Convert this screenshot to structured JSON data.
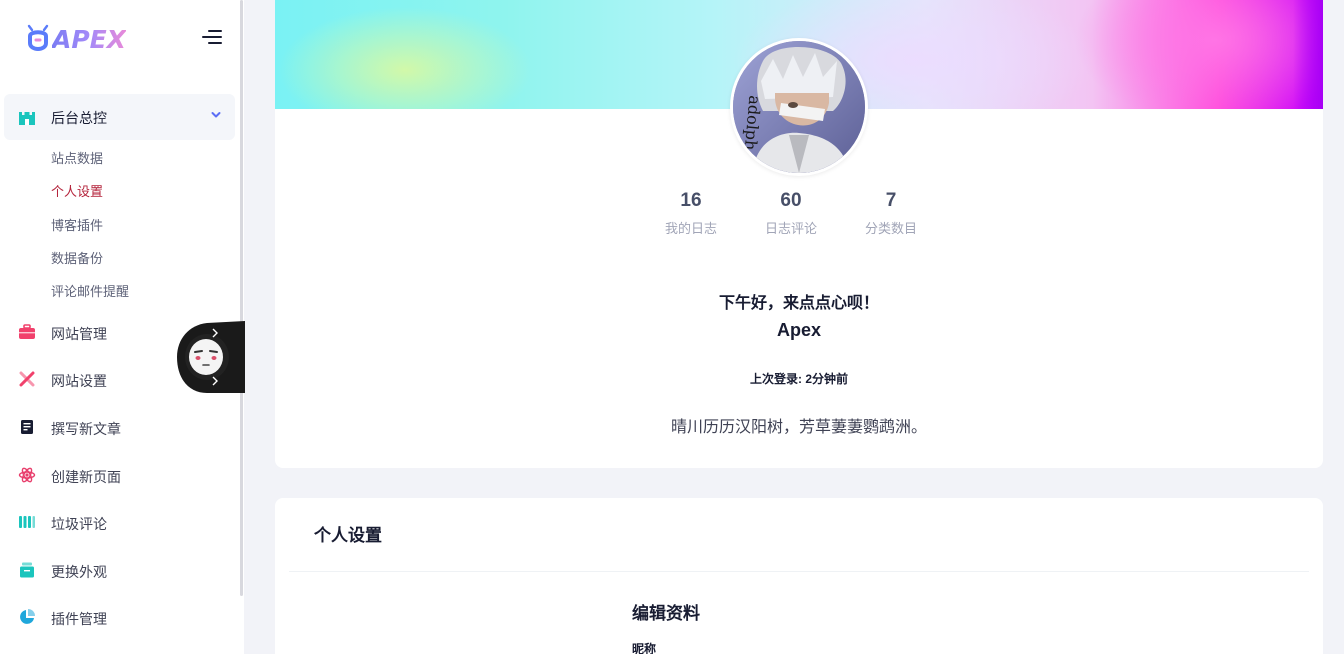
{
  "brand": {
    "name": "APEX"
  },
  "sidebar": {
    "group": {
      "label": "后台总控",
      "icon": "castle-icon",
      "expanded": true
    },
    "sub_items": [
      {
        "label": "站点数据",
        "active": false
      },
      {
        "label": "个人设置",
        "active": true
      },
      {
        "label": "博客插件",
        "active": false
      },
      {
        "label": "数据备份",
        "active": false
      },
      {
        "label": "评论邮件提醒",
        "active": false
      }
    ],
    "items": [
      {
        "label": "网站管理",
        "icon": "briefcase-icon",
        "color": "#f1416c"
      },
      {
        "label": "网站设置",
        "icon": "tools-icon",
        "color": "#f1416c"
      },
      {
        "label": "撰写新文章",
        "icon": "document-icon",
        "color": "#181c32"
      },
      {
        "label": "创建新页面",
        "icon": "atom-icon",
        "color": "#e83e6c"
      },
      {
        "label": "垃圾评论",
        "icon": "columns-icon",
        "color": "#1bc5bd"
      },
      {
        "label": "更换外观",
        "icon": "shop-icon",
        "color": "#1bc5bd"
      },
      {
        "label": "插件管理",
        "icon": "pie-chart-icon",
        "color": "#20a7db"
      }
    ]
  },
  "profile": {
    "stats": [
      {
        "value": "16",
        "label": "我的日志"
      },
      {
        "value": "60",
        "label": "日志评论"
      },
      {
        "value": "7",
        "label": "分类数目"
      }
    ],
    "greeting": "下午好，来点点心呗！",
    "username": "Apex",
    "last_login": "上次登录: 2分钟前",
    "motto": "晴川历历汉阳树，芳草萋萋鹦鹉洲。"
  },
  "settings": {
    "title": "个人设置",
    "edit_title": "编辑资料",
    "nickname_label": "昵称"
  },
  "colors": {
    "accent": "#b4233b",
    "active_bg": "#f4f6fa",
    "page_bg": "#f2f3f8"
  }
}
